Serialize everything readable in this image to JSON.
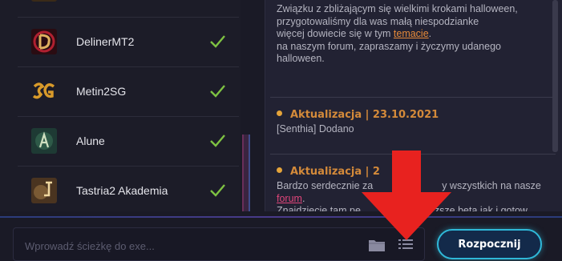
{
  "servers": [
    {
      "name": "",
      "status": "ok",
      "icon": "server-logo-icon"
    },
    {
      "name": "DelinerMT2",
      "status": "ok",
      "icon": "deliner-logo-icon"
    },
    {
      "name": "Metin2SG",
      "status": "ok",
      "icon": "metin2sg-logo-icon"
    },
    {
      "name": "Alune",
      "status": "ok",
      "icon": "alune-logo-icon"
    },
    {
      "name": "Tastria2 Akademia",
      "status": "ok",
      "icon": "tastria2-logo-icon"
    }
  ],
  "news": {
    "intro": {
      "line1": "Związku z zbliżającym się wielkimi krokami halloween,",
      "line2": "przygotowaliśmy dla was małą niespodzianke",
      "line3_pre": "więcej dowiecie się w tym ",
      "line3_link": "temacie",
      "line3_post": ".",
      "line4": "na naszym forum, zapraszamy i życzymy udanego",
      "line5": "halloween."
    },
    "items": [
      {
        "title": "Aktualizacja | 23.10.2021",
        "body": "[Senthia] Dodano"
      },
      {
        "title": "Aktualizacja | 2",
        "body_line1": "Bardzo serdecznie za",
        "body_line1_end": "y wszystkich na nasze",
        "body_link": "forum",
        "body_link_post": ".",
        "body_line3": "Znajdziecie tam pe",
        "body_line3_end": "zsze beta jak i gotow"
      }
    ]
  },
  "bottom_bar": {
    "path_placeholder": "Wprowadź ścieżkę do exe...",
    "path_value": "",
    "start_label": "Rozpocznij"
  },
  "colors": {
    "check": "#7ec242",
    "accent_orange": "#e68a3a",
    "accent_pink": "#e0457a",
    "start_border": "#2fb8d8",
    "annotation_red": "#e8221f"
  }
}
